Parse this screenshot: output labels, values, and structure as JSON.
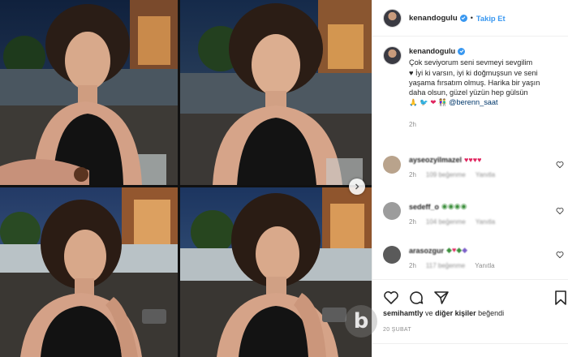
{
  "post": {
    "username": "kenandogulu",
    "follow_separator": "•",
    "follow_label": "Takip Et",
    "caption_line1": "Çok seviyorum seni sevmeyi sevgilim",
    "caption_line2": "♥ İyi ki varsın, iyi ki doğmuşsun ve seni",
    "caption_line3": "yaşama fırsatım olmuş. Harika bir yaşın",
    "caption_line4": "daha olsun, güzel yüzün hep gülsün",
    "caption_mention": "@berenn_saat",
    "caption_time": "2h"
  },
  "comments": [
    {
      "user": "ayseozyilmazel",
      "time": "2h",
      "likes": "109 beğenme",
      "reply": "Yanıtla",
      "avatar_color": "#b9a38c"
    },
    {
      "user": "sedeff_o",
      "time": "2h",
      "likes": "104 beğenme",
      "reply": "Yanıtla",
      "avatar_color": "#9c9c9c"
    },
    {
      "user": "arasozgur",
      "time": "2h",
      "likes": "117 beğenme",
      "reply": "Yanıtla",
      "avatar_color": "#5a5a5a"
    }
  ],
  "likes": {
    "user": "semihamtly",
    "connector": "ve",
    "others": "diğer kişiler",
    "verb": "beğendi"
  },
  "date": "20 ŞUBAT",
  "watermark": "b",
  "colors": {
    "accent": "#3897f0",
    "mention": "#00376b",
    "muted": "#8e8e8e",
    "text": "#262626"
  }
}
